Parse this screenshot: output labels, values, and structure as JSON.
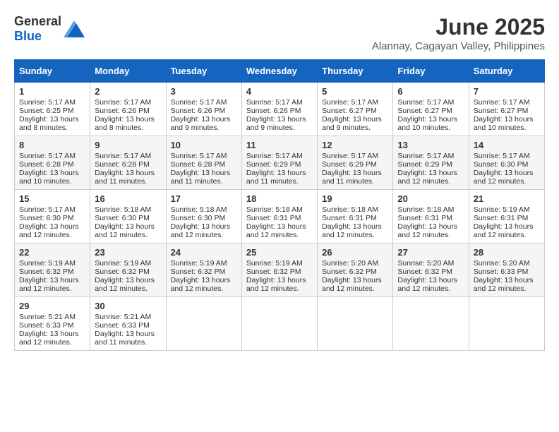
{
  "header": {
    "logo_general": "General",
    "logo_blue": "Blue",
    "month_year": "June 2025",
    "location": "Alannay, Cagayan Valley, Philippines"
  },
  "days_of_week": [
    "Sunday",
    "Monday",
    "Tuesday",
    "Wednesday",
    "Thursday",
    "Friday",
    "Saturday"
  ],
  "weeks": [
    [
      {
        "day": "1",
        "sunrise": "5:17 AM",
        "sunset": "6:25 PM",
        "daylight": "13 hours and 8 minutes."
      },
      {
        "day": "2",
        "sunrise": "5:17 AM",
        "sunset": "6:26 PM",
        "daylight": "13 hours and 8 minutes."
      },
      {
        "day": "3",
        "sunrise": "5:17 AM",
        "sunset": "6:26 PM",
        "daylight": "13 hours and 9 minutes."
      },
      {
        "day": "4",
        "sunrise": "5:17 AM",
        "sunset": "6:26 PM",
        "daylight": "13 hours and 9 minutes."
      },
      {
        "day": "5",
        "sunrise": "5:17 AM",
        "sunset": "6:27 PM",
        "daylight": "13 hours and 9 minutes."
      },
      {
        "day": "6",
        "sunrise": "5:17 AM",
        "sunset": "6:27 PM",
        "daylight": "13 hours and 10 minutes."
      },
      {
        "day": "7",
        "sunrise": "5:17 AM",
        "sunset": "6:27 PM",
        "daylight": "13 hours and 10 minutes."
      }
    ],
    [
      {
        "day": "8",
        "sunrise": "5:17 AM",
        "sunset": "6:28 PM",
        "daylight": "13 hours and 10 minutes."
      },
      {
        "day": "9",
        "sunrise": "5:17 AM",
        "sunset": "6:28 PM",
        "daylight": "13 hours and 11 minutes."
      },
      {
        "day": "10",
        "sunrise": "5:17 AM",
        "sunset": "6:28 PM",
        "daylight": "13 hours and 11 minutes."
      },
      {
        "day": "11",
        "sunrise": "5:17 AM",
        "sunset": "6:29 PM",
        "daylight": "13 hours and 11 minutes."
      },
      {
        "day": "12",
        "sunrise": "5:17 AM",
        "sunset": "6:29 PM",
        "daylight": "13 hours and 11 minutes."
      },
      {
        "day": "13",
        "sunrise": "5:17 AM",
        "sunset": "6:29 PM",
        "daylight": "13 hours and 12 minutes."
      },
      {
        "day": "14",
        "sunrise": "5:17 AM",
        "sunset": "6:30 PM",
        "daylight": "13 hours and 12 minutes."
      }
    ],
    [
      {
        "day": "15",
        "sunrise": "5:17 AM",
        "sunset": "6:30 PM",
        "daylight": "13 hours and 12 minutes."
      },
      {
        "day": "16",
        "sunrise": "5:18 AM",
        "sunset": "6:30 PM",
        "daylight": "13 hours and 12 minutes."
      },
      {
        "day": "17",
        "sunrise": "5:18 AM",
        "sunset": "6:30 PM",
        "daylight": "13 hours and 12 minutes."
      },
      {
        "day": "18",
        "sunrise": "5:18 AM",
        "sunset": "6:31 PM",
        "daylight": "13 hours and 12 minutes."
      },
      {
        "day": "19",
        "sunrise": "5:18 AM",
        "sunset": "6:31 PM",
        "daylight": "13 hours and 12 minutes."
      },
      {
        "day": "20",
        "sunrise": "5:18 AM",
        "sunset": "6:31 PM",
        "daylight": "13 hours and 12 minutes."
      },
      {
        "day": "21",
        "sunrise": "5:19 AM",
        "sunset": "6:31 PM",
        "daylight": "13 hours and 12 minutes."
      }
    ],
    [
      {
        "day": "22",
        "sunrise": "5:19 AM",
        "sunset": "6:32 PM",
        "daylight": "13 hours and 12 minutes."
      },
      {
        "day": "23",
        "sunrise": "5:19 AM",
        "sunset": "6:32 PM",
        "daylight": "13 hours and 12 minutes."
      },
      {
        "day": "24",
        "sunrise": "5:19 AM",
        "sunset": "6:32 PM",
        "daylight": "13 hours and 12 minutes."
      },
      {
        "day": "25",
        "sunrise": "5:19 AM",
        "sunset": "6:32 PM",
        "daylight": "13 hours and 12 minutes."
      },
      {
        "day": "26",
        "sunrise": "5:20 AM",
        "sunset": "6:32 PM",
        "daylight": "13 hours and 12 minutes."
      },
      {
        "day": "27",
        "sunrise": "5:20 AM",
        "sunset": "6:32 PM",
        "daylight": "13 hours and 12 minutes."
      },
      {
        "day": "28",
        "sunrise": "5:20 AM",
        "sunset": "6:33 PM",
        "daylight": "13 hours and 12 minutes."
      }
    ],
    [
      {
        "day": "29",
        "sunrise": "5:21 AM",
        "sunset": "6:33 PM",
        "daylight": "13 hours and 12 minutes."
      },
      {
        "day": "30",
        "sunrise": "5:21 AM",
        "sunset": "6:33 PM",
        "daylight": "13 hours and 11 minutes."
      },
      null,
      null,
      null,
      null,
      null
    ]
  ],
  "labels": {
    "sunrise": "Sunrise:",
    "sunset": "Sunset:",
    "daylight": "Daylight:"
  }
}
